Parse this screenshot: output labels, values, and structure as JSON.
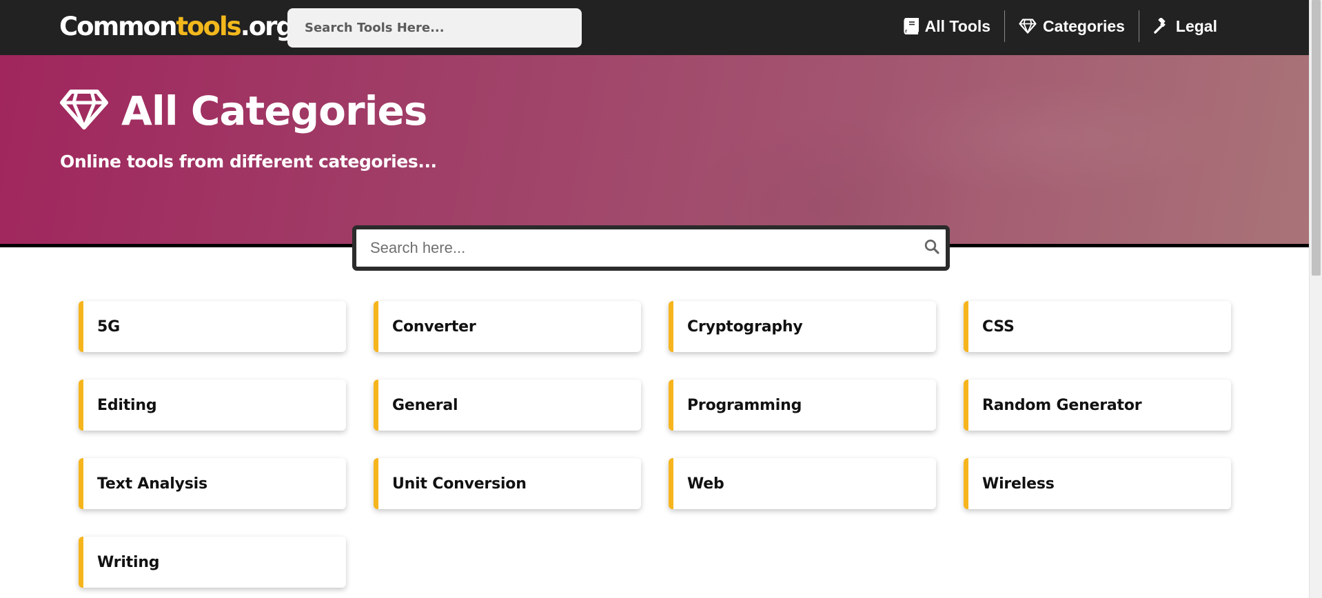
{
  "header": {
    "logo": {
      "part1": "Common",
      "part2": "tools",
      "part3": ".org"
    },
    "search_placeholder": "Search Tools Here...",
    "nav": [
      {
        "label": "All Tools",
        "icon": "book-icon"
      },
      {
        "label": "Categories",
        "icon": "diamond-icon"
      },
      {
        "label": "Legal",
        "icon": "gavel-icon"
      }
    ]
  },
  "hero": {
    "icon": "diamond-icon",
    "title": "All Categories",
    "subtitle": "Online tools from different categories..."
  },
  "search": {
    "placeholder": "Search here...",
    "icon": "search-icon"
  },
  "categories": [
    "5G",
    "Converter",
    "Cryptography",
    "CSS",
    "Editing",
    "General",
    "Programming",
    "Random Generator",
    "Text Analysis",
    "Unit Conversion",
    "Web",
    "Wireless",
    "Writing"
  ],
  "colors": {
    "navbar": "#222222",
    "accent": "#f6b51d",
    "hero_start": "#a0265d",
    "hero_end": "#a97378"
  }
}
